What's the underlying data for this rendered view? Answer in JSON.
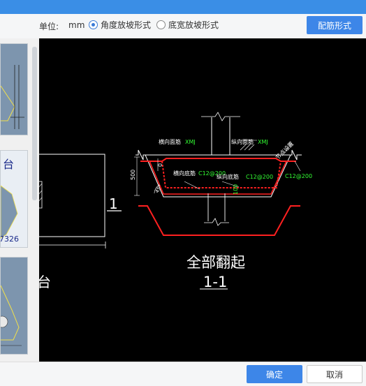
{
  "toolbar": {
    "unit_label": "单位:",
    "unit_value": "mm",
    "radio_angle": "角度放坡形式",
    "radio_width": "底宽放坡形式",
    "rebar_button": "配筋形式"
  },
  "drawing": {
    "label_top_rebar_h": "横向面筋",
    "label_top_rebar_h_code": "XMJ",
    "label_top_rebar_v": "纵向面筋",
    "label_top_rebar_v_code": "XMJ",
    "label_bottom_rebar_h": "横向底筋",
    "label_bottom_rebar_h_spec": "C12@200",
    "label_bottom_rebar_v": "纵向底筋",
    "label_bottom_rebar_v_spec": "C12@200",
    "label_right_spec": "C12@200",
    "label_node": "节点设置",
    "dim_500": "500",
    "dim_0": "0",
    "dim_100": "100",
    "angle_45": "45°",
    "caption": "全部翻起",
    "section": "1-1",
    "left_section_mark": "1",
    "left_fragment_text": "台"
  },
  "thumbnails": {
    "fragment_1": "台",
    "fragment_2": "7326",
    "fragment_3": "台"
  },
  "footer": {
    "ok": "确定",
    "cancel": "取消"
  },
  "colors": {
    "accent": "#3d86e8",
    "canvas_bg": "#000000",
    "rebar_red": "#ff2020",
    "dim_green": "#33ff33"
  }
}
